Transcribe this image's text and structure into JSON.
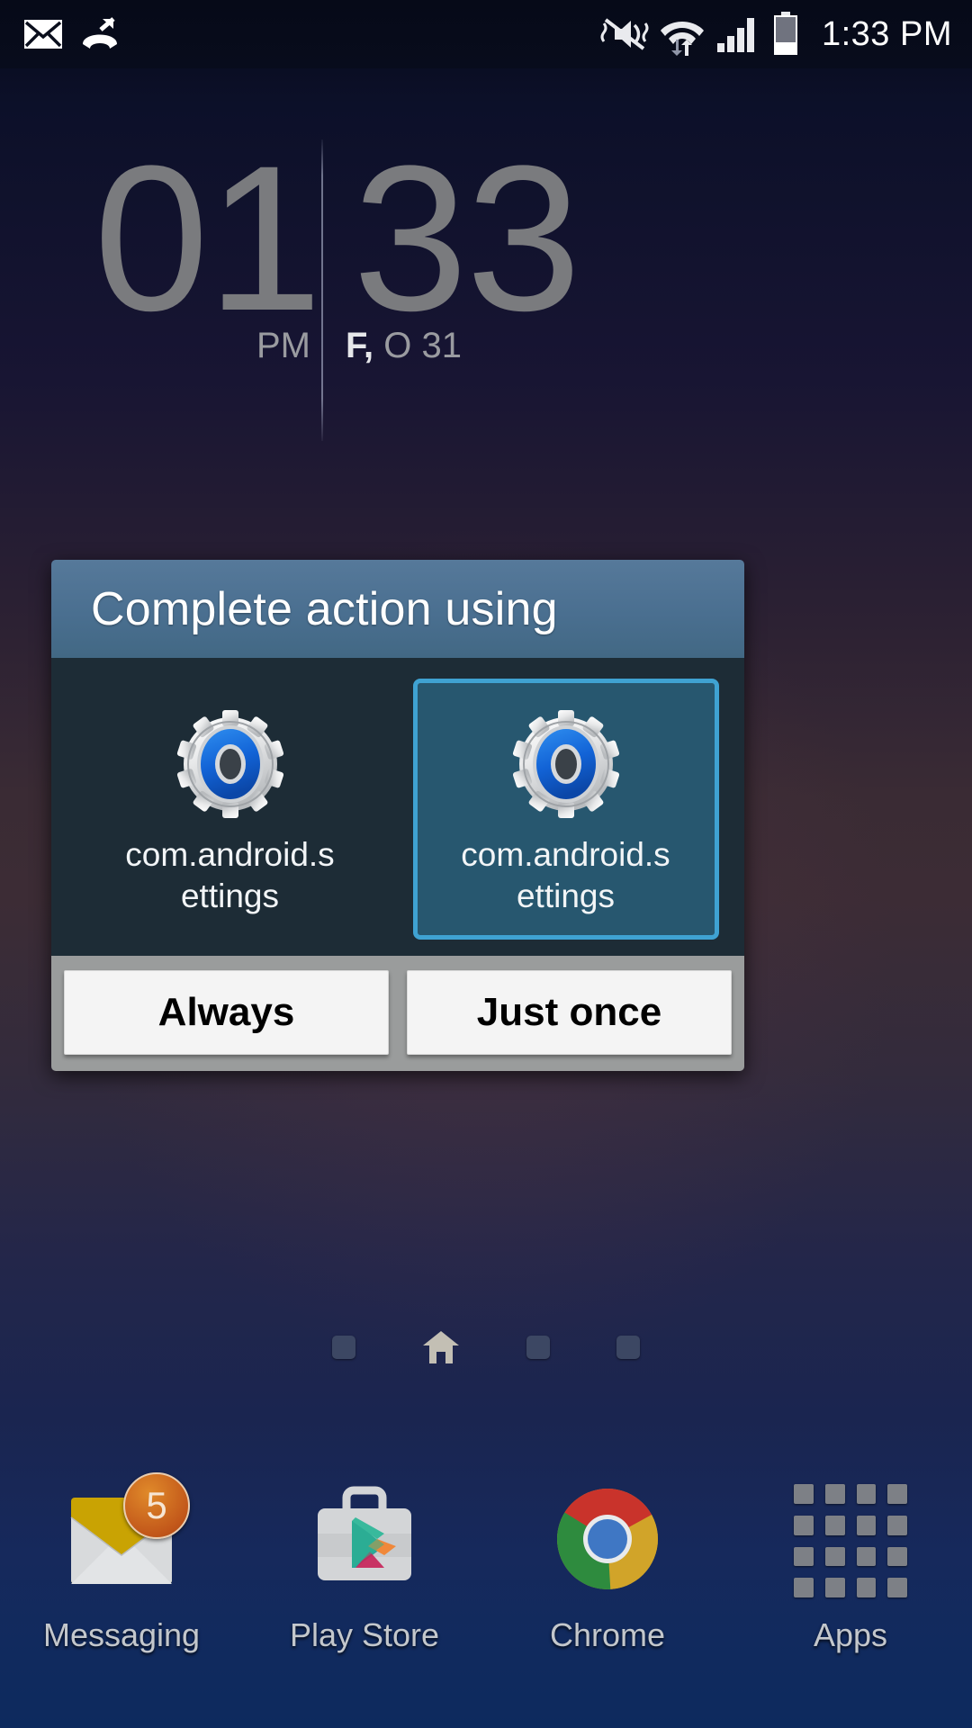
{
  "status_bar": {
    "left_icons": [
      "new-message-envelope-icon",
      "missed-call-icon"
    ],
    "right_icons": [
      "vibrate-mute-icon",
      "wifi-data-transfer-icon",
      "cellular-signal-icon",
      "battery-icon"
    ],
    "time": "1:33 PM"
  },
  "clock_widget": {
    "hour": "01",
    "minute": "33",
    "ampm": "PM",
    "day_of_week": "F,",
    "date": "O 31"
  },
  "dialog": {
    "title": "Complete action using",
    "apps": [
      {
        "label": "com.android.settings",
        "icon": "settings-gear-icon",
        "selected": false
      },
      {
        "label": "com.android.settings",
        "icon": "settings-gear-icon",
        "selected": true
      }
    ],
    "buttons": [
      {
        "label": "Always",
        "name": "always-button"
      },
      {
        "label": "Just once",
        "name": "just-once-button"
      }
    ]
  },
  "page_indicator": {
    "pages": [
      "dot",
      "home",
      "dot",
      "dot"
    ],
    "current_index": 1
  },
  "dock": {
    "items": [
      {
        "label": "Messaging",
        "icon": "messaging-envelope-icon",
        "badge": "5"
      },
      {
        "label": "Play Store",
        "icon": "play-store-icon",
        "badge": ""
      },
      {
        "label": "Chrome",
        "icon": "chrome-icon",
        "badge": ""
      },
      {
        "label": "Apps",
        "icon": "apps-grid-icon",
        "badge": ""
      }
    ]
  },
  "colors": {
    "dialog_header": "#4a6f90",
    "dialog_body": "#1d2c36",
    "selection_border": "#3fa2d2",
    "selection_fill": "#27576f",
    "footer_gray": "#9a9c9c",
    "badge_orange": "#c2571a",
    "clock_digits": "#7a7b7e"
  }
}
